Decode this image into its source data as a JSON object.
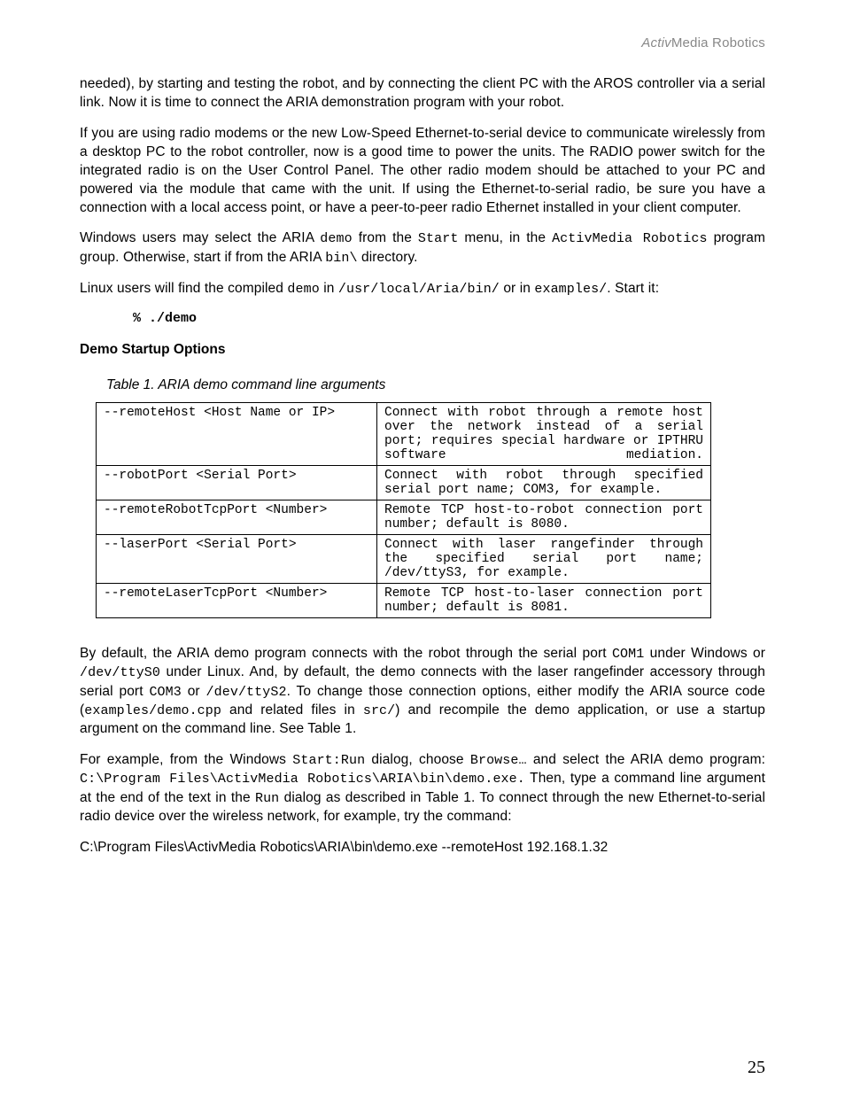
{
  "header": {
    "activ": "Activ",
    "rest": "Media Robotics"
  },
  "para1": "needed), by starting and testing the robot, and by connecting the client PC with the AROS controller via a serial link.  Now it is time to connect the ARIA demonstration program with your robot.",
  "para2": "If you are using radio modems or the new Low-Speed Ethernet-to-serial device to communicate wirelessly from a desktop PC to the robot controller, now is a good time to power the units.  The RADIO power switch for the integrated radio is on the User Control Panel.  The other radio modem should be attached to your PC and powered via the module that came with the unit.  If using the Ethernet-to-serial radio, be sure you have a connection with a local access point, or have a peer-to-peer radio Ethernet installed in your client computer.",
  "para3": {
    "t1": "Windows users may select the ARIA ",
    "c1": "demo",
    "t2": " from the ",
    "c2": "Start",
    "t3": " menu, in the ",
    "c3": "ActivMedia Robotics",
    "t4": " program group.  Otherwise, start if from the ARIA ",
    "c4": "bin\\",
    "t5": " directory."
  },
  "para4": {
    "t1": "Linux users will find the compiled ",
    "c1": "demo",
    "t2": " in ",
    "c2": "/usr/local/Aria/bin/",
    "t3": " or in ",
    "c3": "examples/",
    "t4": ".  Start it:"
  },
  "cmd": "% ./demo",
  "section_head": "Demo Startup Options",
  "table_caption": "Table 1. ARIA demo command line arguments",
  "table": [
    {
      "opt": "--remoteHost <Host Name or IP>",
      "desc": "Connect with robot through a remote host over the network instead of a serial port; requires special hardware or IPTHRU software mediation."
    },
    {
      "opt": "--robotPort <Serial Port>",
      "desc": "Connect with robot through specified serial port name; COM3, for example."
    },
    {
      "opt": "--remoteRobotTcpPort <Number>",
      "desc": "Remote TCP host-to-robot connection port number; default is 8080."
    },
    {
      "opt": "--laserPort <Serial Port>",
      "desc": "Connect with laser rangefinder through the specified serial port name; /dev/ttyS3, for example."
    },
    {
      "opt": "--remoteLaserTcpPort <Number>",
      "desc": "Remote TCP host-to-laser connection port number; default is 8081."
    }
  ],
  "para5": {
    "t1": "By default, the ARIA demo program connects with the robot through the serial port ",
    "c1": "COM1",
    "t2": " under Windows or ",
    "c2": "/dev/ttyS0",
    "t3": " under Linux.  And, by default, the demo connects with the laser rangefinder accessory through serial port ",
    "c3": "COM3",
    "t4": " or ",
    "c4": "/dev/ttyS2",
    "t5": ".  To change those connection options, either modify the ARIA source code (",
    "c5": "examples/demo.cpp",
    "t6": " and related files in ",
    "c6": "src/",
    "t7": ") and recompile the demo application, or use a startup argument on the command line.  See Table 1."
  },
  "para6": {
    "t1": "For example, from the Windows ",
    "c1": "Start:Run",
    "t2": " dialog, choose ",
    "c2": "Browse…",
    "t3": " and select the ARIA demo program: ",
    "c3": "C:\\Program Files\\ActivMedia Robotics\\ARIA\\bin\\demo.exe.",
    "t4": " Then, type a command line argument at the end of the text in the ",
    "c4": "Run",
    "t5": " dialog as described in Table 1.  To connect through the new Ethernet-to-serial radio device over the wireless network, for example, try the command:"
  },
  "para7": "C:\\Program Files\\ActivMedia Robotics\\ARIA\\bin\\demo.exe --remoteHost 192.168.1.32",
  "page_number": "25"
}
